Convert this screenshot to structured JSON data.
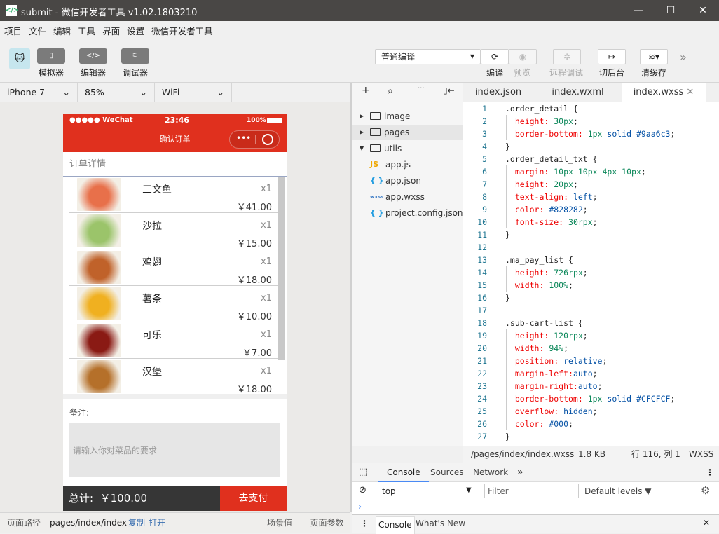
{
  "window": {
    "title": "submit - 微信开发者工具 v1.02.1803210",
    "logo": "</>",
    "minimize": "—",
    "maximize": "☐",
    "close": "✕"
  },
  "menu": [
    "项目",
    "文件",
    "编辑",
    "工具",
    "界面",
    "设置",
    "微信开发者工具"
  ],
  "toolbar": {
    "simulator": "模拟器",
    "editor": "编辑器",
    "debugger": "调试器",
    "compile_mode": "普通编译",
    "compile": "编译",
    "preview": "预览",
    "remote_debug": "远程调试",
    "background": "切后台",
    "clear_cache": "清缓存"
  },
  "simbar": {
    "device": "iPhone 7",
    "zoom": "85%",
    "network": "WiFi"
  },
  "phone": {
    "carrier": "●●●●● WeChat",
    "time": "23:46",
    "battery": "100%",
    "nav_title": "确认订单",
    "section_title": "订单详情",
    "items": [
      {
        "name": "三文鱼",
        "qty": "x1",
        "price": "￥41.00",
        "color": "#e8704a"
      },
      {
        "name": "沙拉",
        "qty": "x1",
        "price": "￥15.00",
        "color": "#9bc46a"
      },
      {
        "name": "鸡翅",
        "qty": "x1",
        "price": "￥18.00",
        "color": "#c0622a"
      },
      {
        "name": "薯条",
        "qty": "x1",
        "price": "￥10.00",
        "color": "#f0b020"
      },
      {
        "name": "可乐",
        "qty": "x1",
        "price": "￥7.00",
        "color": "#8a1a14"
      },
      {
        "name": "汉堡",
        "qty": "x1",
        "price": "￥18.00",
        "color": "#b5702a"
      }
    ],
    "note_label": "备注:",
    "note_placeholder": "请输入你对菜品的要求",
    "total_label": "总计:",
    "total_value": "￥100.00",
    "pay_button": "去支付"
  },
  "tree": [
    {
      "name": "image",
      "type": "folder",
      "expanded": false
    },
    {
      "name": "pages",
      "type": "folder",
      "expanded": false
    },
    {
      "name": "utils",
      "type": "folder",
      "expanded": true
    },
    {
      "name": "app.js",
      "type": "js",
      "icon": "JS"
    },
    {
      "name": "app.json",
      "type": "json",
      "icon": "{ }"
    },
    {
      "name": "app.wxss",
      "type": "wxss",
      "icon": "wxss"
    },
    {
      "name": "project.config.json",
      "type": "json",
      "icon": "{ }"
    }
  ],
  "tabs": [
    "index.json",
    "index.wxml",
    "index.wxss"
  ],
  "code": [
    [
      [
        "sel",
        ".order_detail {"
      ]
    ],
    [
      [
        "prop",
        "  height: "
      ],
      [
        "num",
        "30px"
      ],
      [
        "pun",
        ";"
      ]
    ],
    [
      [
        "prop",
        "  border-bottom: "
      ],
      [
        "num",
        "1px"
      ],
      [
        "val",
        " solid #9aa6c3"
      ],
      [
        "pun",
        ";"
      ]
    ],
    [
      [
        "pun",
        "}"
      ]
    ],
    [
      [
        "sel",
        ".order_detail_txt {"
      ]
    ],
    [
      [
        "prop",
        "  margin: "
      ],
      [
        "num",
        "10px 10px 4px 10px"
      ],
      [
        "pun",
        ";"
      ]
    ],
    [
      [
        "prop",
        "  height: "
      ],
      [
        "num",
        "20px"
      ],
      [
        "pun",
        ";"
      ]
    ],
    [
      [
        "prop",
        "  text-align: "
      ],
      [
        "val",
        "left"
      ],
      [
        "pun",
        ";"
      ]
    ],
    [
      [
        "prop",
        "  color: "
      ],
      [
        "val",
        "#828282"
      ],
      [
        "pun",
        ";"
      ]
    ],
    [
      [
        "prop",
        "  font-size: "
      ],
      [
        "num",
        "30rpx"
      ],
      [
        "pun",
        ";"
      ]
    ],
    [
      [
        "pun",
        "}"
      ]
    ],
    [],
    [
      [
        "sel",
        ".ma_pay_list {"
      ]
    ],
    [
      [
        "prop",
        "  height: "
      ],
      [
        "num",
        "726rpx"
      ],
      [
        "pun",
        ";"
      ]
    ],
    [
      [
        "prop",
        "  width: "
      ],
      [
        "num",
        "100%"
      ],
      [
        "pun",
        ";"
      ]
    ],
    [
      [
        "pun",
        "}"
      ]
    ],
    [],
    [
      [
        "sel",
        ".sub-cart-list {"
      ]
    ],
    [
      [
        "prop",
        "  height: "
      ],
      [
        "num",
        "120rpx"
      ],
      [
        "pun",
        ";"
      ]
    ],
    [
      [
        "prop",
        "  width: "
      ],
      [
        "num",
        "94%"
      ],
      [
        "pun",
        ";"
      ]
    ],
    [
      [
        "prop",
        "  position: "
      ],
      [
        "val",
        "relative"
      ],
      [
        "pun",
        ";"
      ]
    ],
    [
      [
        "prop",
        "  margin-left:"
      ],
      [
        "val",
        "auto"
      ],
      [
        "pun",
        ";"
      ]
    ],
    [
      [
        "prop",
        "  margin-right:"
      ],
      [
        "val",
        "auto"
      ],
      [
        "pun",
        ";"
      ]
    ],
    [
      [
        "prop",
        "  border-bottom: "
      ],
      [
        "num",
        "1px"
      ],
      [
        "val",
        " solid #CFCFCF"
      ],
      [
        "pun",
        ";"
      ]
    ],
    [
      [
        "prop",
        "  overflow: "
      ],
      [
        "val",
        "hidden"
      ],
      [
        "pun",
        ";"
      ]
    ],
    [
      [
        "prop",
        "  color: "
      ],
      [
        "val",
        "#000"
      ],
      [
        "pun",
        ";"
      ]
    ],
    [
      [
        "pun",
        "}"
      ]
    ]
  ],
  "editor_status": {
    "path": "/pages/index/index.wxss",
    "size": "1.8 KB",
    "position": "行 116, 列 1",
    "lang": "WXSS"
  },
  "devtools": {
    "tabs": [
      "Console",
      "Sources",
      "Network"
    ],
    "more": "»",
    "context": "top",
    "filter_placeholder": "Filter",
    "levels": "Default levels ▼",
    "prompt": "›",
    "drawer_tabs": [
      "Console",
      "What's New"
    ],
    "close": "✕"
  },
  "bottom": {
    "path_label": "页面路径",
    "path": "pages/index/index",
    "copy": "复制",
    "open": "打开",
    "scene": "场景值",
    "params": "页面参数"
  }
}
